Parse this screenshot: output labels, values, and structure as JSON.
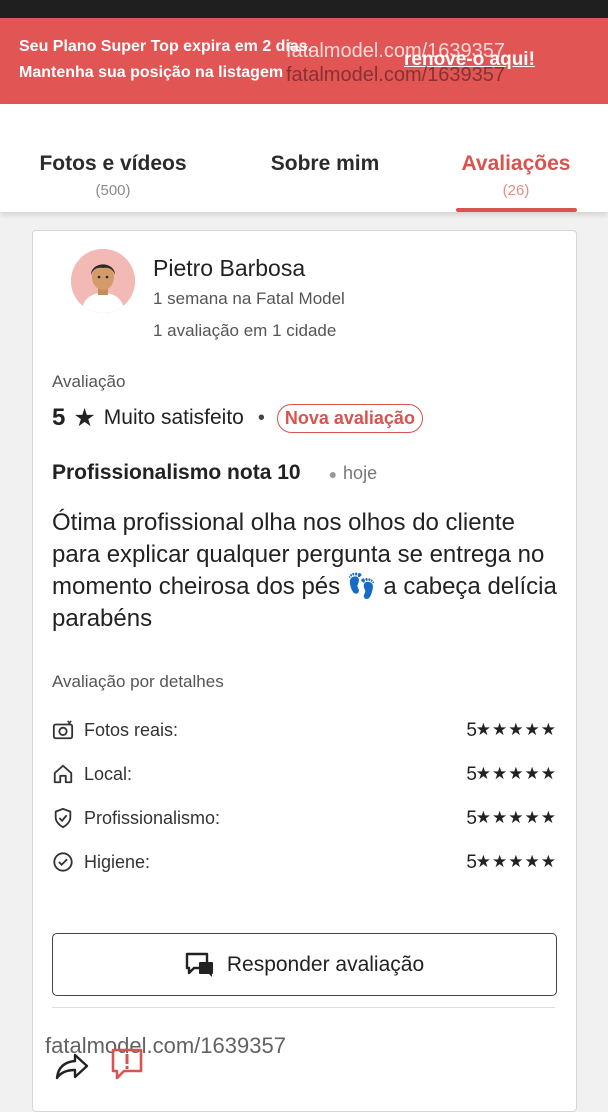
{
  "banner": {
    "line1": "Seu Plano Super Top expira em 2 dias.",
    "line2": "Mantenha sua posição na listagem",
    "renew_link": "renove-o aqui!",
    "watermark_top": "fatalmodel.com/1639357",
    "watermark_overlay": "fatalmodel.com/1639357",
    "color": "#e25555"
  },
  "tabs": [
    {
      "label": "Fotos e vídeos",
      "count": "(500)"
    },
    {
      "label": "Sobre mim",
      "count": ""
    },
    {
      "label": "Avaliações",
      "count": "(26)"
    }
  ],
  "active_tab": "Avaliações",
  "accent_color": "#d9534f",
  "review": {
    "reviewer_name": "Pietro Barbosa",
    "reviewer_since": "1 semana na Fatal Model",
    "reviewer_reviews": "1 avaliação em 1 cidade",
    "rating_label": "Avaliação",
    "rating": "5",
    "rating_text": "Muito satisfeito",
    "badge": "Nova avaliação",
    "title": "Profissionalismo nota 10",
    "when": "hoje",
    "body": "Ótima profissional olha nos olhos do cliente para explicar qualquer pergunta se entrega no momento cheirosa dos pés 👣 a cabeça delícia parabéns",
    "details_label": "Avaliação por detalhes",
    "details": [
      {
        "icon": "camera-icon",
        "label": "Fotos reais:",
        "score": "5",
        "stars": 5
      },
      {
        "icon": "home-icon",
        "label": "Local:",
        "score": "5",
        "stars": 5
      },
      {
        "icon": "shield-check-icon",
        "label": "Profissionalismo:",
        "score": "5",
        "stars": 5
      },
      {
        "icon": "check-circle-icon",
        "label": "Higiene:",
        "score": "5",
        "stars": 5
      }
    ],
    "reply_button": "Responder avaliação"
  },
  "bottom": {
    "watermark": "fatalmodel.com/1639357"
  }
}
